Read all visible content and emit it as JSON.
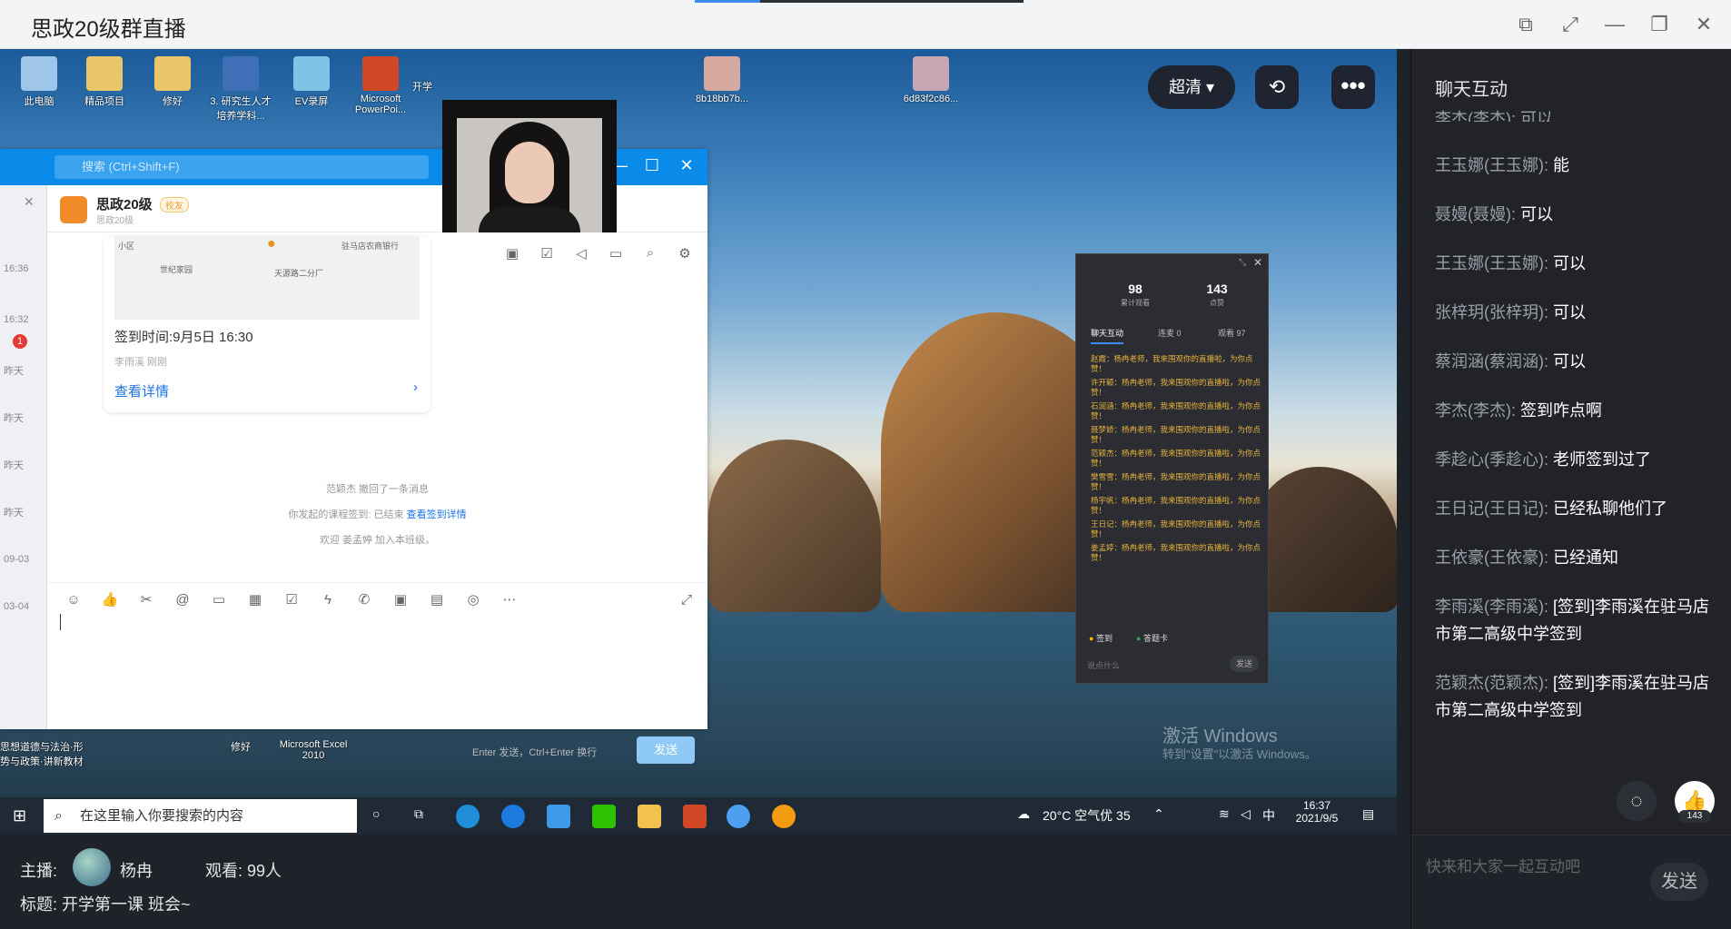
{
  "window": {
    "title": "思政20级群直播"
  },
  "qq": {
    "search_placeholder": "搜索 (Ctrl+Shift+F)",
    "group_name": "思政20级",
    "group_tag": "校友",
    "group_sub": "思政20级",
    "side_times": [
      "16:36",
      "16:32",
      "昨天",
      "昨天",
      "昨天",
      "昨天",
      "09-03",
      "03-04"
    ],
    "badge": "1",
    "map_labels": [
      "小区",
      "世纪家园",
      "驻马店农商银行",
      "天源路二分厂"
    ],
    "checkin_time": "签到时间:9月5日 16:30",
    "checkin_who": "李雨溪 刚刚",
    "view_detail": "查看详情",
    "sys1": "范颖杰 撤回了一条消息",
    "sys2": "你发起的课程签到: 已结束 ",
    "sys2_link": "查看签到详情",
    "sys3": "欢迎 姜孟婷 加入本班级。",
    "input_hint": "Enter 发送，Ctrl+Enter 换行",
    "send": "发送"
  },
  "desktop": {
    "icons": [
      "此电脑",
      "精品项目",
      "修好",
      "3. 研究生人才培养学科...",
      "EV录屏",
      "Microsoft PowerPoi...",
      "开学",
      "8b18bb7b...",
      "6d83f2c86..."
    ],
    "bottom_icons": [
      "思想道德与法治·形势与政策·讲新教材",
      "修好",
      "Microsoft Excel 2010"
    ],
    "watermark1": "激活 Windows",
    "watermark2": "转到\"设置\"以激活 Windows。"
  },
  "live_panel": {
    "stat1": "98",
    "stat1_label": "累计观看",
    "stat2": "143",
    "stat2_label": "点赞",
    "tabs": [
      "聊天互动",
      "连麦 0",
      "观看 97"
    ],
    "messages": [
      "赵霞：杨冉老师，我来围观你的直播啦，为你点赞！",
      "许开颖：杨冉老师，我来围观你的直播啦，为你点赞！",
      "石润涵：杨冉老师，我来围观你的直播啦，为你点赞！",
      "聂梦娇：杨冉老师，我来围观你的直播啦，为你点赞！",
      "范颖杰：杨冉老师，我来围观你的直播啦，为你点赞！",
      "樊雪雪：杨冉老师，我来围观你的直播啦，为你点赞！",
      "杨宇帆：杨冉老师，我来围观你的直播啦，为你点赞！",
      "王日记：杨冉老师，我来围观你的直播啦，为你点赞！",
      "姜孟婷：杨冉老师，我来围观你的直播啦，为你点赞！"
    ],
    "checkin": "签到",
    "answer_card": "答题卡",
    "input_ph": "说点什么",
    "send": "发送"
  },
  "video_controls": {
    "quality": "超清"
  },
  "taskbar": {
    "search": "在这里输入你要搜索的内容",
    "weather": "20°C 空气优 35",
    "ime": "中",
    "time": "16:37",
    "date": "2021/9/5"
  },
  "info": {
    "host_label": "主播:",
    "host_name": "杨冉",
    "viewers": "观看: 99人",
    "title": "标题: 开学第一课 班会~"
  },
  "chat": {
    "header": "聊天互动",
    "cut_top": "李杰(李杰): 可以",
    "messages": [
      {
        "name": "王玉娜(王玉娜): ",
        "text": "能"
      },
      {
        "name": "聂嫚(聂嫚): ",
        "text": "可以"
      },
      {
        "name": "王玉娜(王玉娜): ",
        "text": "可以"
      },
      {
        "name": "张梓玥(张梓玥): ",
        "text": "可以"
      },
      {
        "name": "蔡润涵(蔡润涵): ",
        "text": "可以"
      },
      {
        "name": "李杰(李杰): ",
        "text": "签到咋点啊"
      },
      {
        "name": "季趁心(季趁心): ",
        "text": "老师签到过了"
      },
      {
        "name": "王日记(王日记): ",
        "text": "已经私聊他们了"
      },
      {
        "name": "王依豪(王依豪): ",
        "text": "已经通知"
      },
      {
        "name": "李雨溪(李雨溪): ",
        "text": "[签到]李雨溪在驻马店市第二高级中学签到"
      },
      {
        "name": "范颖杰(范颖杰): ",
        "text": "[签到]李雨溪在驻马店市第二高级中学签到"
      }
    ],
    "likes": "143",
    "input_ph": "快来和大家一起互动吧",
    "send": "发送"
  }
}
